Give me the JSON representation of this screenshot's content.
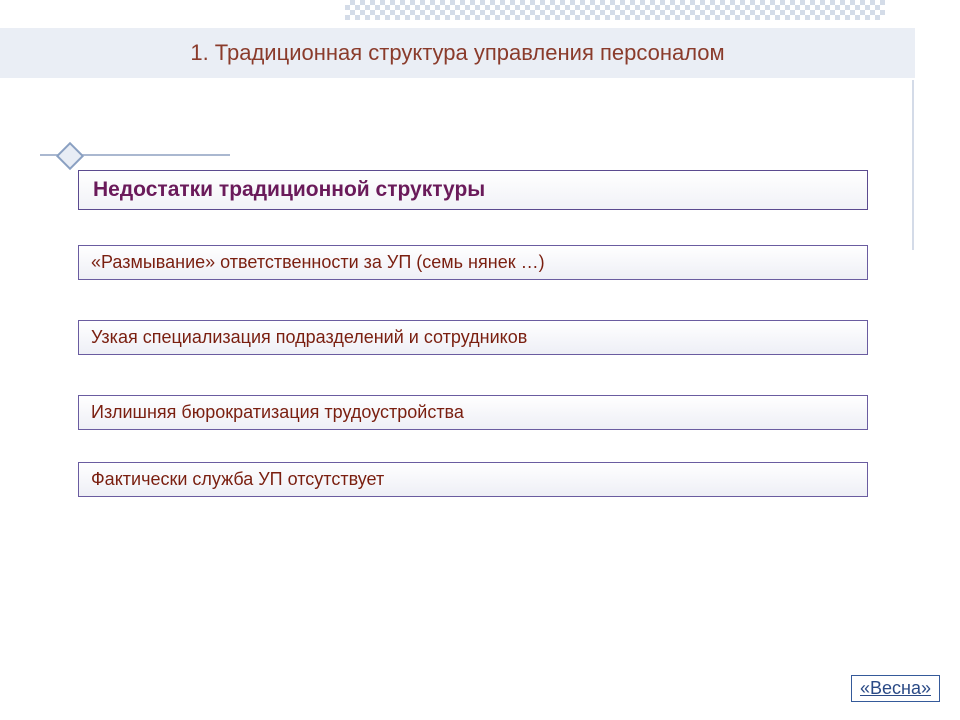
{
  "header": {
    "title": "1. Традиционная структура управления персоналом"
  },
  "section": {
    "heading": "Недостатки традиционной структуры"
  },
  "items": [
    "«Размывание» ответственности за УП (семь нянек …)",
    "Узкая специализация подразделений и сотрудников",
    "Излишняя бюрократизация трудоустройства",
    "Фактически служба УП отсутствует"
  ],
  "footer": {
    "link": "«Весна»"
  }
}
